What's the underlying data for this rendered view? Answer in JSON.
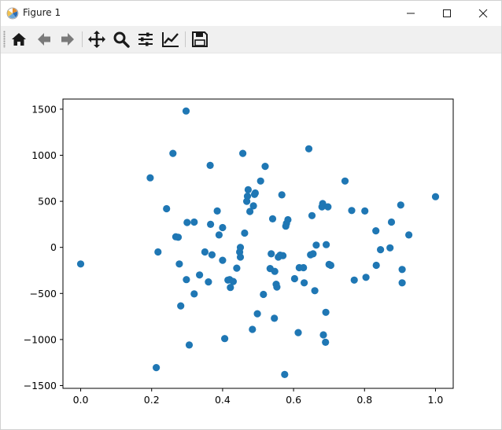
{
  "window": {
    "title": "Figure 1"
  },
  "toolbar": {
    "buttons": [
      {
        "name": "home-icon",
        "tooltip": "Reset original view"
      },
      {
        "name": "back-icon",
        "tooltip": "Back to previous view"
      },
      {
        "name": "forward-icon",
        "tooltip": "Forward to next view"
      },
      {
        "name": "pan-icon",
        "tooltip": "Pan axes"
      },
      {
        "name": "zoom-icon",
        "tooltip": "Zoom to rectangle"
      },
      {
        "name": "subplots-icon",
        "tooltip": "Configure subplots"
      },
      {
        "name": "customize-icon",
        "tooltip": "Edit axis"
      },
      {
        "name": "save-icon",
        "tooltip": "Save the figure"
      }
    ]
  },
  "colors": {
    "marker": "#1f77b4",
    "axes": "#000000",
    "toolbar_bg": "#f0f0f0"
  },
  "chart_data": {
    "type": "scatter",
    "title": "",
    "xlabel": "",
    "ylabel": "",
    "xlim": [
      -0.05,
      1.05
    ],
    "ylim": [
      -1530,
      1610
    ],
    "grid": false,
    "xticks": [
      0.0,
      0.2,
      0.4,
      0.6,
      0.8,
      1.0
    ],
    "xtick_labels": [
      "0.0",
      "0.2",
      "0.4",
      "0.6",
      "0.8",
      "1.0"
    ],
    "yticks": [
      -1500,
      -1000,
      -500,
      0,
      500,
      1000,
      1500
    ],
    "ytick_labels": [
      "−1500",
      "−1000",
      "−500",
      "0",
      "500",
      "1000",
      "1500"
    ],
    "points": [
      [
        0.0,
        -180
      ],
      [
        0.196,
        755
      ],
      [
        0.213,
        -1305
      ],
      [
        0.218,
        -50
      ],
      [
        0.242,
        420
      ],
      [
        0.26,
        1020
      ],
      [
        0.268,
        115
      ],
      [
        0.275,
        110
      ],
      [
        0.278,
        -180
      ],
      [
        0.282,
        -635
      ],
      [
        0.297,
        1480
      ],
      [
        0.298,
        -350
      ],
      [
        0.3,
        270
      ],
      [
        0.306,
        -1060
      ],
      [
        0.32,
        275
      ],
      [
        0.32,
        -505
      ],
      [
        0.335,
        -300
      ],
      [
        0.35,
        -50
      ],
      [
        0.36,
        -375
      ],
      [
        0.365,
        890
      ],
      [
        0.366,
        250
      ],
      [
        0.37,
        -80
      ],
      [
        0.385,
        395
      ],
      [
        0.39,
        135
      ],
      [
        0.4,
        215
      ],
      [
        0.4,
        -140
      ],
      [
        0.406,
        -990
      ],
      [
        0.415,
        -355
      ],
      [
        0.42,
        -350
      ],
      [
        0.422,
        -435
      ],
      [
        0.43,
        -370
      ],
      [
        0.44,
        -225
      ],
      [
        0.448,
        -50
      ],
      [
        0.45,
        0
      ],
      [
        0.45,
        -105
      ],
      [
        0.457,
        1020
      ],
      [
        0.462,
        155
      ],
      [
        0.468,
        500
      ],
      [
        0.47,
        555
      ],
      [
        0.472,
        625
      ],
      [
        0.477,
        390
      ],
      [
        0.484,
        -890
      ],
      [
        0.487,
        450
      ],
      [
        0.49,
        575
      ],
      [
        0.492,
        590
      ],
      [
        0.498,
        -720
      ],
      [
        0.507,
        720
      ],
      [
        0.515,
        -510
      ],
      [
        0.52,
        880
      ],
      [
        0.534,
        -230
      ],
      [
        0.537,
        -70
      ],
      [
        0.541,
        310
      ],
      [
        0.546,
        -770
      ],
      [
        0.547,
        -260
      ],
      [
        0.551,
        -400
      ],
      [
        0.553,
        -430
      ],
      [
        0.557,
        -105
      ],
      [
        0.562,
        -85
      ],
      [
        0.567,
        570
      ],
      [
        0.57,
        -90
      ],
      [
        0.575,
        -1380
      ],
      [
        0.578,
        230
      ],
      [
        0.58,
        260
      ],
      [
        0.584,
        300
      ],
      [
        0.603,
        -340
      ],
      [
        0.613,
        -925
      ],
      [
        0.616,
        -220
      ],
      [
        0.628,
        -220
      ],
      [
        0.63,
        -385
      ],
      [
        0.643,
        1070
      ],
      [
        0.648,
        -80
      ],
      [
        0.652,
        345
      ],
      [
        0.655,
        -70
      ],
      [
        0.66,
        -470
      ],
      [
        0.664,
        25
      ],
      [
        0.68,
        440
      ],
      [
        0.682,
        475
      ],
      [
        0.684,
        -950
      ],
      [
        0.69,
        -1030
      ],
      [
        0.691,
        -705
      ],
      [
        0.692,
        30
      ],
      [
        0.697,
        440
      ],
      [
        0.7,
        -185
      ],
      [
        0.705,
        -195
      ],
      [
        0.745,
        720
      ],
      [
        0.764,
        400
      ],
      [
        0.771,
        -355
      ],
      [
        0.801,
        395
      ],
      [
        0.804,
        -325
      ],
      [
        0.832,
        180
      ],
      [
        0.833,
        -195
      ],
      [
        0.845,
        -25
      ],
      [
        0.872,
        -5
      ],
      [
        0.876,
        275
      ],
      [
        0.902,
        460
      ],
      [
        0.906,
        -240
      ],
      [
        0.906,
        -385
      ],
      [
        0.925,
        135
      ],
      [
        1.0,
        550
      ]
    ]
  }
}
